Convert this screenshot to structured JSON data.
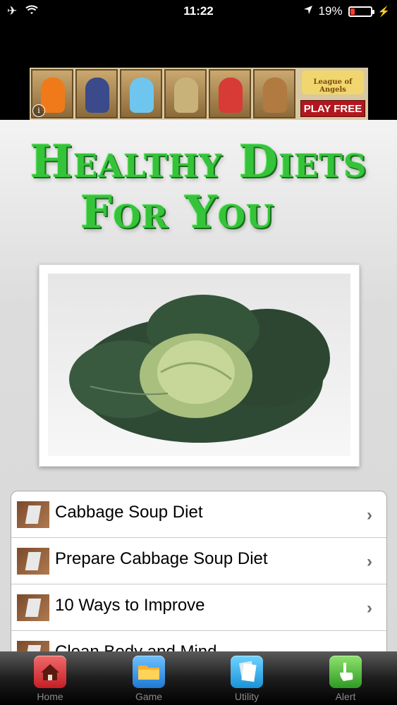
{
  "status_bar": {
    "time": "11:22",
    "battery": "19%",
    "icons": [
      "airplane-icon",
      "wifi-icon",
      "location-arrow-icon",
      "battery-icon",
      "charging-icon"
    ]
  },
  "ad": {
    "cta": "PLAY FREE",
    "brand_text": "League of Angels",
    "info_icon": "info-icon"
  },
  "app": {
    "title_line1": "Healthy Diets",
    "title_line2": "For You"
  },
  "menu": {
    "items": [
      {
        "label": "Cabbage Soup Diet"
      },
      {
        "label": "Prepare Cabbage Soup Diet"
      },
      {
        "label": "10 Ways to Improve"
      },
      {
        "label": "Clean Body and Mind"
      }
    ]
  },
  "tabbar": {
    "tabs": [
      {
        "label": "Home",
        "icon": "home-icon",
        "color": "#d9272e"
      },
      {
        "label": "Game",
        "icon": "folder-icon",
        "color": "#2f8fe2"
      },
      {
        "label": "Utility",
        "icon": "documents-icon",
        "color": "#2fa6e2"
      },
      {
        "label": "Alert",
        "icon": "hand-icon",
        "color": "#3caa2f"
      }
    ]
  }
}
